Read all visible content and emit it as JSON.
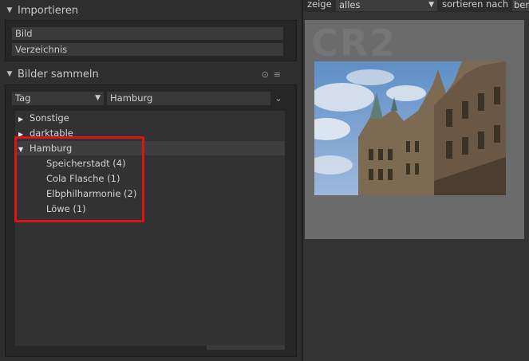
{
  "import_section": {
    "title": "Importieren",
    "arrow": "▼",
    "buttons": [
      "Bild",
      "Verzeichnis"
    ]
  },
  "collect_section": {
    "title": "Bilder sammeln",
    "arrow": "▼",
    "icons": [
      "reset-icon",
      "menu-icon"
    ]
  },
  "filter": {
    "property": "Tag",
    "value": "Hamburg"
  },
  "tree": {
    "items": [
      {
        "label": "Sonstige",
        "expanded": false
      },
      {
        "label": "darktable",
        "expanded": false
      },
      {
        "label": "Hamburg",
        "expanded": true
      }
    ],
    "children": [
      "Speicherstadt (4)",
      "Cola Flasche (1)",
      "Elbphilharmonie (2)",
      "Löwe (1)"
    ]
  },
  "topbar": {
    "show_label": "zeige",
    "show_value": "alles",
    "sort_label": "sortieren nach",
    "sort_value": "ber"
  },
  "thumbnail": {
    "format_label": "CR2"
  },
  "colors": {
    "highlight_box": "#e11212",
    "panel_bg": "#2e2e2e"
  }
}
